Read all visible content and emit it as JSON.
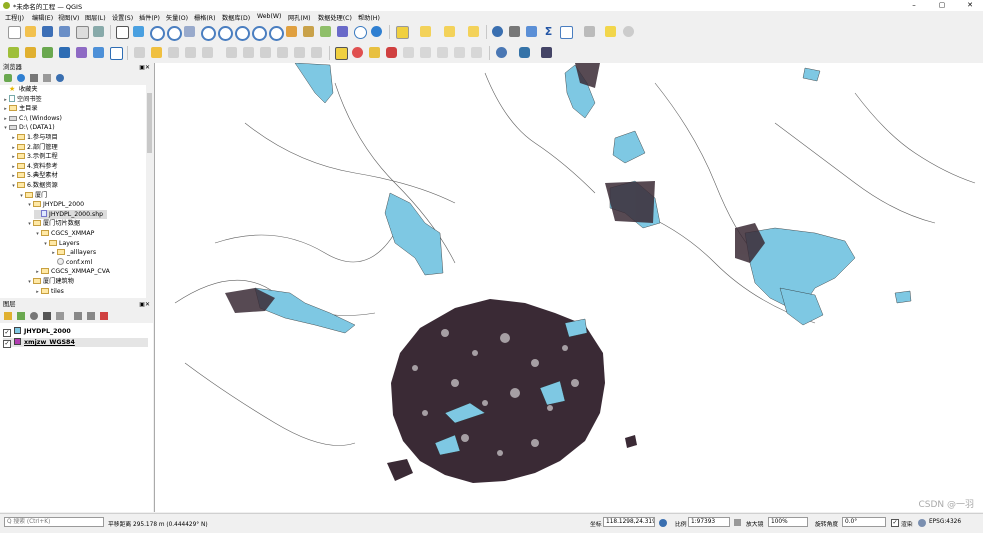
{
  "window": {
    "title": "*未命名的工程 — QGIS",
    "minimize": "–",
    "maximize": "▢",
    "close": "✕"
  },
  "menu": [
    "工程(J)",
    "编辑(E)",
    "视图(V)",
    "图层(L)",
    "设置(S)",
    "插件(P)",
    "矢量(O)",
    "栅格(R)",
    "数据库(D)",
    "Web(W)",
    "网孔(M)",
    "数据处理(C)",
    "帮助(H)"
  ],
  "browser": {
    "title": "浏览器",
    "items": [
      {
        "label": "收藏夹",
        "icon": "star-icon",
        "level": 0,
        "arrow": ""
      },
      {
        "label": "空间书签",
        "icon": "bookmark-icon",
        "level": 0,
        "arrow": "▸"
      },
      {
        "label": "主目录",
        "icon": "home-folder-icon",
        "level": 0,
        "arrow": "▸"
      },
      {
        "label": "C:\\ (Windows)",
        "icon": "drive-icon",
        "level": 0,
        "arrow": "▸"
      },
      {
        "label": "D:\\ (DATA1)",
        "icon": "drive-icon",
        "level": 0,
        "arrow": "▾"
      },
      {
        "label": "1.参与项目",
        "icon": "folder-icon",
        "level": 1,
        "arrow": "▸"
      },
      {
        "label": "2.部门管理",
        "icon": "folder-icon",
        "level": 1,
        "arrow": "▸"
      },
      {
        "label": "3.示例工程",
        "icon": "folder-icon",
        "level": 1,
        "arrow": "▸"
      },
      {
        "label": "4.资料参考",
        "icon": "folder-icon",
        "level": 1,
        "arrow": "▸"
      },
      {
        "label": "5.典型素材",
        "icon": "folder-icon",
        "level": 1,
        "arrow": "▸"
      },
      {
        "label": "6.数据资源",
        "icon": "folder-icon",
        "level": 1,
        "arrow": "▾"
      },
      {
        "label": "厦门",
        "icon": "folder-icon",
        "level": 2,
        "arrow": "▾"
      },
      {
        "label": "JHYDPL_2000",
        "icon": "folder-icon",
        "level": 3,
        "arrow": "▾"
      },
      {
        "label": "JHYDPL_2000.shp",
        "icon": "shapefile-icon",
        "level": 4,
        "arrow": "",
        "selected": true
      },
      {
        "label": "厦门切片数据",
        "icon": "folder-icon",
        "level": 3,
        "arrow": "▾"
      },
      {
        "label": "CGCS_XMMAP",
        "icon": "folder-icon",
        "level": 4,
        "arrow": "▾"
      },
      {
        "label": "Layers",
        "icon": "folder-icon",
        "level": 5,
        "arrow": "▾"
      },
      {
        "label": "_alllayers",
        "icon": "folder-icon",
        "level": 6,
        "arrow": "▸"
      },
      {
        "label": "conf.xml",
        "icon": "gear-icon",
        "level": 6,
        "arrow": ""
      },
      {
        "label": "CGCS_XMMAP_CVA",
        "icon": "folder-icon",
        "level": 4,
        "arrow": "▸"
      },
      {
        "label": "厦门建筑物",
        "icon": "folder-icon",
        "level": 3,
        "arrow": "▾"
      },
      {
        "label": "tiles",
        "icon": "folder-icon",
        "level": 4,
        "arrow": "▸"
      }
    ]
  },
  "layers": {
    "title": "图层",
    "items": [
      {
        "label": "JHYDPL_2000",
        "checked": "✓",
        "color": "#7ec8e3",
        "underline": false
      },
      {
        "label": "xmjzw_WGS84",
        "checked": "✓",
        "color": "#b03cb0",
        "underline": true
      }
    ]
  },
  "status": {
    "search_placeholder": "Q 搜索 (Ctrl+K)",
    "measure": "平移距离 295.178 m (0.444429° N)",
    "coord_label": "坐标",
    "coord": "118.1298,24.3190",
    "scale_label": "比例",
    "scale": "1:97393",
    "magnifier_label": "放大镜",
    "magnifier": "100%",
    "rotation_label": "旋转角度",
    "rotation": "0.0°",
    "render_label": "渲染",
    "crs": "EPSG:4326"
  },
  "watermark": "CSDN @一羽",
  "colors": {
    "water": "#7ec8e3",
    "buildings": "#3a2a35",
    "roads": "#2b2b2b",
    "map_bg": "#ffffff"
  }
}
